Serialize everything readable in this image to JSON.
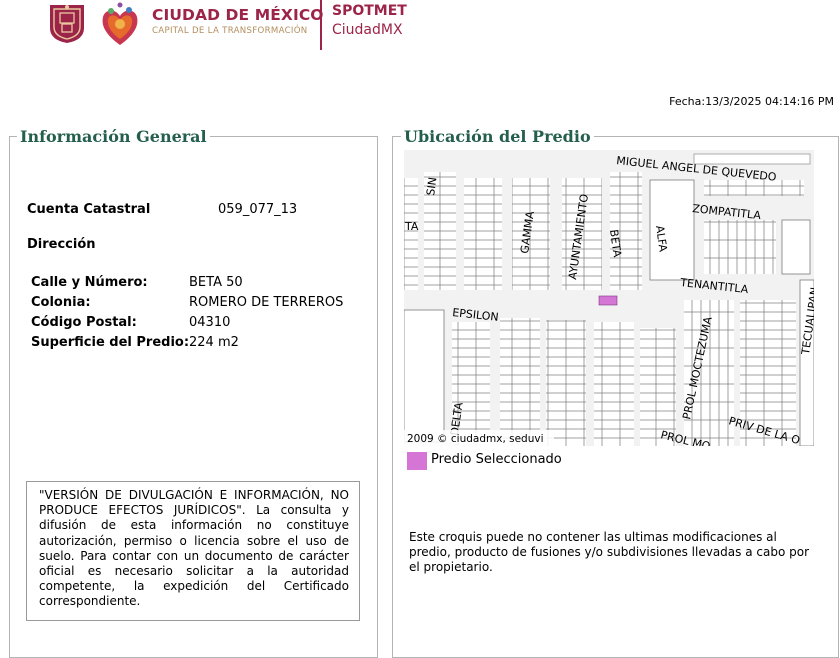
{
  "header": {
    "brand_title": "CIUDAD DE MÉXICO",
    "brand_subtitle": "CAPITAL DE LA TRANSFORMACIÓN",
    "app_title": "SPOTMET",
    "app_subtitle": "CiudadMX",
    "fecha": "Fecha:13/3/2025 04:14:16 PM"
  },
  "general": {
    "legend": "Información General",
    "cuenta_label": "Cuenta Catastral",
    "cuenta_value": "059_077_13",
    "direccion_label": "Dirección",
    "fields": [
      {
        "label": "Calle y Número:",
        "value": "BETA 50"
      },
      {
        "label": "Colonia:",
        "value": "ROMERO DE TERREROS"
      },
      {
        "label": "Código Postal:",
        "value": "04310"
      },
      {
        "label": "Superficie del Predio:",
        "value": "224 m2"
      }
    ],
    "disclaimer": "\"VERSIÓN DE DIVULGACIÓN E INFORMACIÓN, NO PRODUCE EFECTOS JURÍDICOS\". La consulta y difusión de esta información no constituye autorización, permiso o licencia sobre el uso de suelo. Para contar con un documento de carácter oficial es necesario solicitar a la autoridad competente, la expedición del Certificado correspondiente."
  },
  "ubicacion": {
    "legend": "Ubicación del Predio",
    "map_copyright": "2009 © ciudadmx, seduvi",
    "streets": [
      "MIGUEL ANGEL DE QUEVEDO",
      "ZOMPATITLA",
      "TENANTITLA",
      "TECUALIPAN",
      "EPSILON",
      "GAMMA",
      "AYUNTAMIENTO",
      "BETA",
      "ALFA",
      "PROL MOCTEZUMA",
      "PROL MO",
      "PRIV DE LA O",
      "DELTA",
      "SIN",
      "TA"
    ],
    "legend_label": "Predio Seleccionado",
    "note": "Este croquis puede no contener las ultimas modificaciones al predio, producto de fusiones y/o subdivisiones llevadas a cabo por el propietario."
  },
  "colors": {
    "brand": "#9d2449",
    "gold": "#b38e5d",
    "legend": "#245e4c",
    "predio": "#d575d5"
  },
  "icons": [
    "cdmx-coat-of-arms-icon",
    "heart-logo-icon"
  ]
}
